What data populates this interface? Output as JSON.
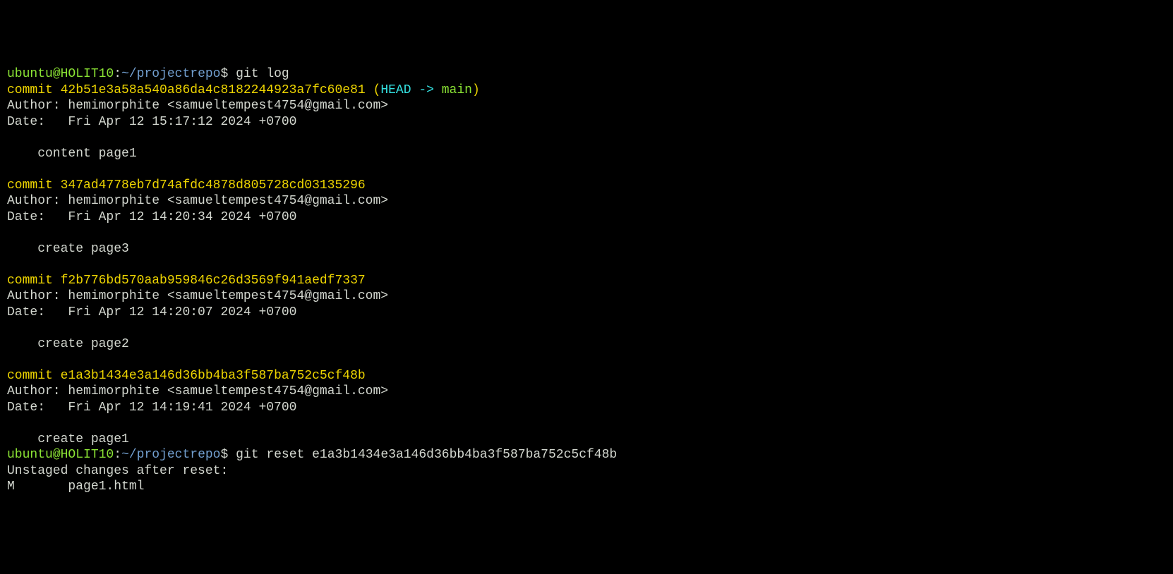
{
  "prompt": {
    "user": "ubuntu",
    "at": "@",
    "host": "HOLIT10",
    "colon": ":",
    "path": "~/projectrepo",
    "dollar": "$"
  },
  "commands": {
    "gitlog": " git log",
    "gitreset": " git reset e1a3b1434e3a146d36bb4ba3f587ba752c5cf48b"
  },
  "commits": [
    {
      "prefix": "commit ",
      "hash": "42b51e3a58a540a86da4c8182244923a7fc60e81",
      "ref_open": " (",
      "ref_head": "HEAD -> ",
      "ref_branch": "main",
      "ref_close": ")",
      "author_line": "Author: hemimorphite <samueltempest4754@gmail.com>",
      "date_line": "Date:   Fri Apr 12 15:17:12 2024 +0700",
      "message": "    content page1"
    },
    {
      "prefix": "commit ",
      "hash": "347ad4778eb7d74afdc4878d805728cd03135296",
      "author_line": "Author: hemimorphite <samueltempest4754@gmail.com>",
      "date_line": "Date:   Fri Apr 12 14:20:34 2024 +0700",
      "message": "    create page3"
    },
    {
      "prefix": "commit ",
      "hash": "f2b776bd570aab959846c26d3569f941aedf7337",
      "author_line": "Author: hemimorphite <samueltempest4754@gmail.com>",
      "date_line": "Date:   Fri Apr 12 14:20:07 2024 +0700",
      "message": "    create page2"
    },
    {
      "prefix": "commit ",
      "hash": "e1a3b1434e3a146d36bb4ba3f587ba752c5cf48b",
      "author_line": "Author: hemimorphite <samueltempest4754@gmail.com>",
      "date_line": "Date:   Fri Apr 12 14:19:41 2024 +0700",
      "message": "    create page1"
    }
  ],
  "reset_output": {
    "unstaged": "Unstaged changes after reset:",
    "modified": "M       page1.html"
  }
}
